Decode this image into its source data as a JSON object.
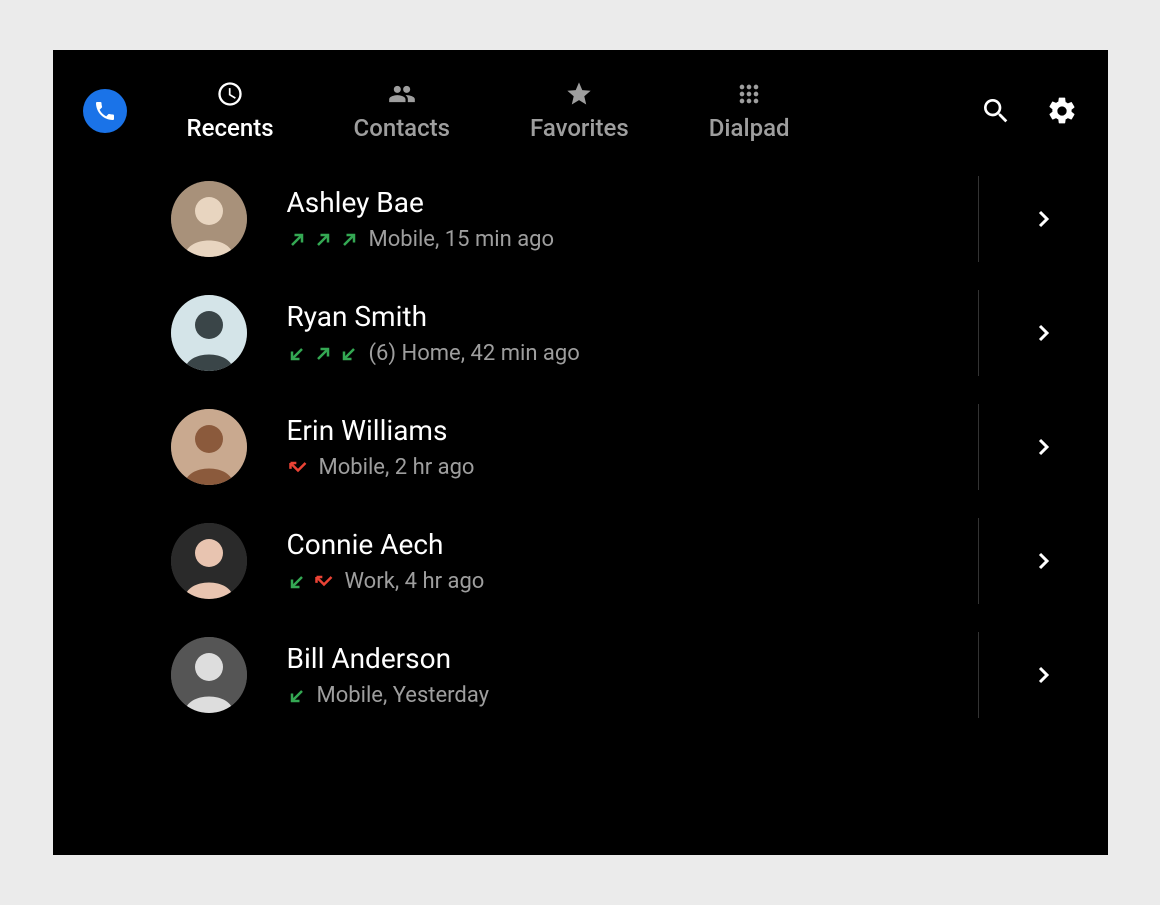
{
  "tabs": [
    {
      "label": "Recents"
    },
    {
      "label": "Contacts"
    },
    {
      "label": "Favorites"
    },
    {
      "label": "Dialpad"
    }
  ],
  "active_tab": 0,
  "calls": [
    {
      "name": "Ashley Bae",
      "arrows": [
        "out",
        "out",
        "out"
      ],
      "count": "",
      "detail": "Mobile, 15 min ago",
      "avatar_bg": "#a8917a",
      "avatar_fg": "#e8d5c0"
    },
    {
      "name": "Ryan Smith",
      "arrows": [
        "in",
        "out",
        "in"
      ],
      "count": "(6) ",
      "detail": "Home, 42 min ago",
      "avatar_bg": "#d4e4e8",
      "avatar_fg": "#3a4548"
    },
    {
      "name": "Erin Williams",
      "arrows": [
        "missed"
      ],
      "count": "",
      "detail": "Mobile, 2 hr ago",
      "avatar_bg": "#c9a98f",
      "avatar_fg": "#8b5a3c"
    },
    {
      "name": "Connie Aech",
      "arrows": [
        "in",
        "missed"
      ],
      "count": "",
      "detail": "Work, 4 hr ago",
      "avatar_bg": "#2a2a2a",
      "avatar_fg": "#e8c4b0"
    },
    {
      "name": "Bill Anderson",
      "arrows": [
        "in"
      ],
      "count": "",
      "detail": "Mobile, Yesterday",
      "avatar_bg": "#555",
      "avatar_fg": "#ddd",
      "bw": true
    }
  ],
  "colors": {
    "green": "#34a853",
    "red": "#ea4335"
  }
}
